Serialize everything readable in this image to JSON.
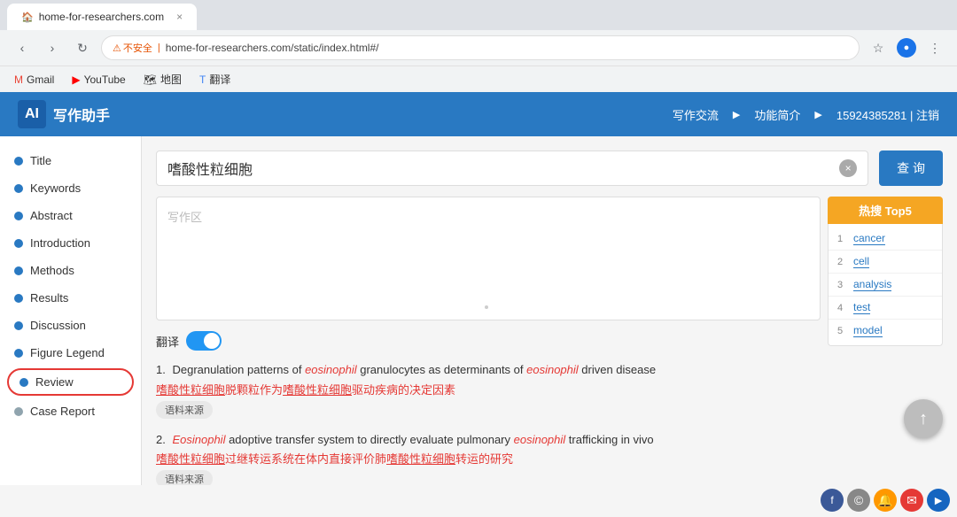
{
  "browser": {
    "address": "home-for-researchers.com/static/index.html#/",
    "insecure_label": "不安全",
    "bookmarks": [
      {
        "label": "Gmail",
        "icon": "G"
      },
      {
        "label": "YouTube",
        "icon": "▶"
      },
      {
        "label": "地图",
        "icon": "🗺"
      },
      {
        "label": "翻译",
        "icon": "T"
      }
    ]
  },
  "header": {
    "logo_text": "写作助手",
    "nav_items": [
      "写作交流",
      "功能简介",
      "15924385281 | 注销"
    ]
  },
  "sidebar": {
    "items": [
      {
        "label": "Title"
      },
      {
        "label": "Keywords"
      },
      {
        "label": "Abstract"
      },
      {
        "label": "Introduction"
      },
      {
        "label": "Methods"
      },
      {
        "label": "Results"
      },
      {
        "label": "Discussion"
      },
      {
        "label": "Figure Legend"
      },
      {
        "label": "Review"
      },
      {
        "label": "Case Report"
      }
    ]
  },
  "search": {
    "query": "嗜酸性粒细胞",
    "clear_icon": "×",
    "button_label": "查 询",
    "placeholder": "写作区"
  },
  "translate": {
    "label": "翻译",
    "toggle_on": true
  },
  "results": [
    {
      "number": "1.",
      "title_en_parts": [
        {
          "text": "Degranulation patterns of ",
          "em": false
        },
        {
          "text": "eosinophil",
          "em": true
        },
        {
          "text": " granulocytes as determinants of ",
          "em": false
        },
        {
          "text": "eosinophil",
          "em": true
        },
        {
          "text": " driven disease",
          "em": false
        }
      ],
      "title_zh_parts": [
        {
          "text": "嗜酸性粒细胞",
          "underline": true
        },
        {
          "text": "脱颗粒作为",
          "underline": false
        },
        {
          "text": "嗜酸性粒细胞",
          "underline": true
        },
        {
          "text": "驱动疾病的决定因素",
          "underline": false
        }
      ],
      "source_tag": "语料来源"
    },
    {
      "number": "2.",
      "title_en_parts": [
        {
          "text": "Eosinophil",
          "em": true
        },
        {
          "text": " adoptive transfer system to directly evaluate pulmonary ",
          "em": false
        },
        {
          "text": "eosinophil",
          "em": true
        },
        {
          "text": " trafficking in vivo",
          "em": false
        }
      ],
      "title_zh_parts": [
        {
          "text": "嗜酸性粒细胞",
          "underline": true
        },
        {
          "text": "过继转运系统在体内直接评价肺",
          "underline": false
        },
        {
          "text": "嗜酸性粒细胞",
          "underline": true
        },
        {
          "text": "转运的研究",
          "underline": false
        }
      ],
      "source_tag": "语料来源"
    }
  ],
  "hot": {
    "header": "热搜 Top5",
    "items": [
      {
        "num": "1",
        "word": "cancer"
      },
      {
        "num": "2",
        "word": "cell"
      },
      {
        "num": "3",
        "word": "analysis"
      },
      {
        "num": "4",
        "word": "test"
      },
      {
        "num": "5",
        "word": "model"
      }
    ]
  },
  "scroll_top_icon": "↑",
  "social_icons": [
    "f",
    "©",
    "🔔",
    "✉",
    "►"
  ]
}
